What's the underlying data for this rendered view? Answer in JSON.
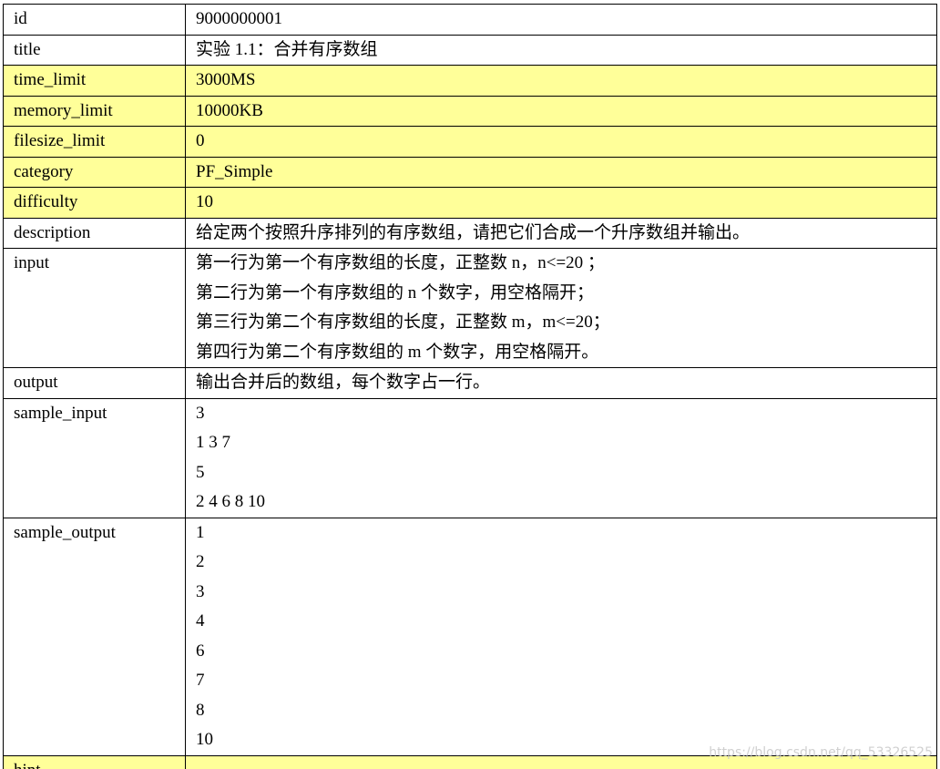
{
  "rows": [
    {
      "key": "id",
      "lines": [
        "9000000001"
      ],
      "highlight": false
    },
    {
      "key": "title",
      "lines": [
        "实验 1.1：合并有序数组"
      ],
      "highlight": false
    },
    {
      "key": "time_limit",
      "lines": [
        "3000MS"
      ],
      "highlight": true
    },
    {
      "key": "memory_limit",
      "lines": [
        "10000KB"
      ],
      "highlight": true
    },
    {
      "key": "filesize_limit",
      "lines": [
        "0"
      ],
      "highlight": true
    },
    {
      "key": "category",
      "lines": [
        "PF_Simple"
      ],
      "highlight": true
    },
    {
      "key": "difficulty",
      "lines": [
        "10"
      ],
      "highlight": true
    },
    {
      "key": "description",
      "lines": [
        "给定两个按照升序排列的有序数组，请把它们合成一个升序数组并输出。"
      ],
      "highlight": false
    },
    {
      "key": "input",
      "lines": [
        "第一行为第一个有序数组的长度，正整数 n，n<=20 ；",
        "第二行为第一个有序数组的 n 个数字，用空格隔开；",
        "第三行为第二个有序数组的长度，正整数 m，m<=20；",
        "第四行为第二个有序数组的 m 个数字，用空格隔开。"
      ],
      "highlight": false
    },
    {
      "key": "output",
      "lines": [
        "输出合并后的数组，每个数字占一行。"
      ],
      "highlight": false
    },
    {
      "key": "sample_input",
      "lines": [
        "3",
        "1 3 7",
        "5",
        "2 4 6 8 10"
      ],
      "highlight": false
    },
    {
      "key": "sample_output",
      "lines": [
        "1",
        "2",
        "3",
        "4",
        "6",
        "7",
        "8",
        "10"
      ],
      "highlight": false
    },
    {
      "key": "hint",
      "lines": [
        ""
      ],
      "highlight": true
    }
  ],
  "watermark": "https://blog.csdn.net/qq_53326525",
  "colors": {
    "highlight": "#ffff99",
    "border": "#000000"
  }
}
